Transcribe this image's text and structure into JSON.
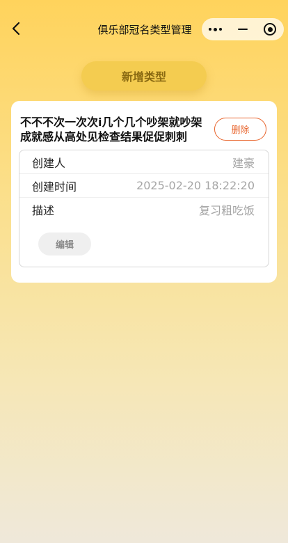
{
  "nav": {
    "title": "俱乐部冠名类型管理",
    "back_icon": "chevron-left-icon",
    "capsule": {
      "more_icon": "more-dots-icon",
      "minimize_icon": "minus-icon",
      "close_icon": "target-circle-icon"
    }
  },
  "actions": {
    "add_label": "新增类型"
  },
  "card": {
    "title": "不不不次一次次i几个几个吵架就吵架成就感从高处见检查结果促促刺刺",
    "delete_label": "删除",
    "fields": [
      {
        "key": "创建人",
        "value": "建豪"
      },
      {
        "key": "创建时间",
        "value": "2025-02-20 18:22:20"
      },
      {
        "key": "描述",
        "value": "复习粗吃饭"
      }
    ],
    "edit_label": "编辑"
  },
  "colors": {
    "accent": "#F4CC50",
    "delete": "#E8642C",
    "gradient_top": "#FFD35C",
    "gradient_bottom": "#EFE8DA"
  }
}
